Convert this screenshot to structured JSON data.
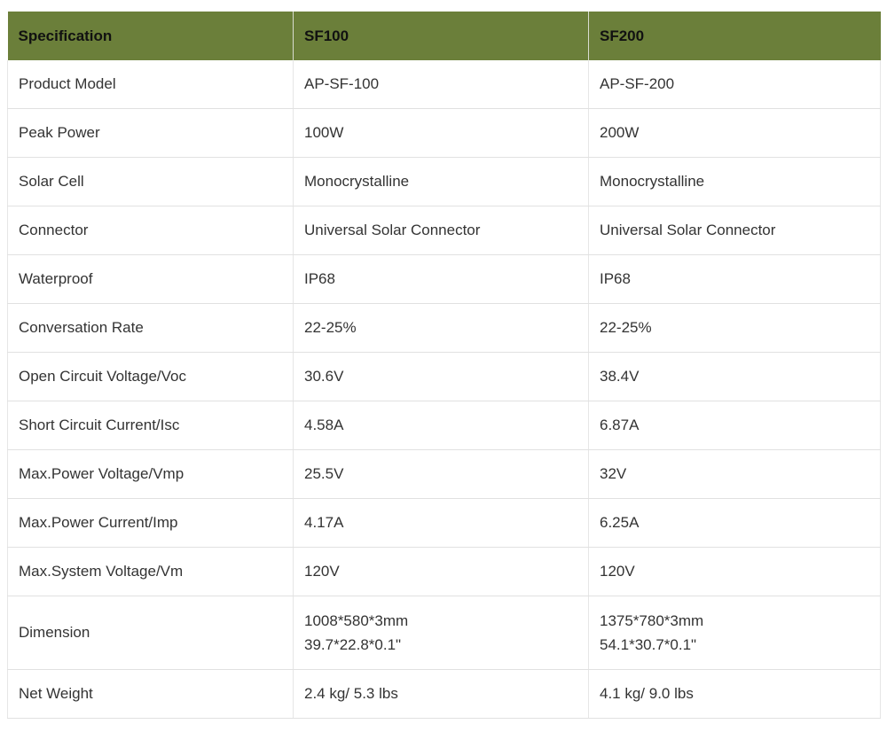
{
  "header": {
    "col1": "Specification",
    "col2": "SF100",
    "col3": "SF200"
  },
  "rows": [
    {
      "spec": "Product Model",
      "sf100": "AP-SF-100",
      "sf200": "AP-SF-200"
    },
    {
      "spec": "Peak Power",
      "sf100": "100W",
      "sf200": "200W"
    },
    {
      "spec": "Solar Cell",
      "sf100": "Monocrystalline",
      "sf200": "Monocrystalline"
    },
    {
      "spec": "Connector",
      "sf100": "Universal Solar Connector",
      "sf200": "Universal Solar Connector"
    },
    {
      "spec": "Waterproof",
      "sf100": "IP68",
      "sf200": "IP68"
    },
    {
      "spec": "Conversation Rate",
      "sf100": "22-25%",
      "sf200": "22-25%"
    },
    {
      "spec": "Open Circuit Voltage/Voc",
      "sf100": "30.6V",
      "sf200": "38.4V"
    },
    {
      "spec": "Short Circuit Current/Isc",
      "sf100": "4.58A",
      "sf200": "6.87A"
    },
    {
      "spec": "Max.Power Voltage/Vmp",
      "sf100": "25.5V",
      "sf200": "32V"
    },
    {
      "spec": "Max.Power Current/Imp",
      "sf100": "4.17A",
      "sf200": "6.25A"
    },
    {
      "spec": "Max.System Voltage/Vm",
      "sf100": "120V",
      "sf200": "120V"
    },
    {
      "spec": "Dimension",
      "sf100": [
        "1008*580*3mm",
        "39.7*22.8*0.1\""
      ],
      "sf200": [
        "1375*780*3mm",
        "54.1*30.7*0.1\""
      ]
    },
    {
      "spec": "Net Weight",
      "sf100": "2.4 kg/ 5.3 lbs",
      "sf200": "4.1 kg/ 9.0 lbs"
    }
  ],
  "colors": {
    "header_bg": "#6b7f3a",
    "header_text": "#111111",
    "border": "#e1e1e1"
  }
}
